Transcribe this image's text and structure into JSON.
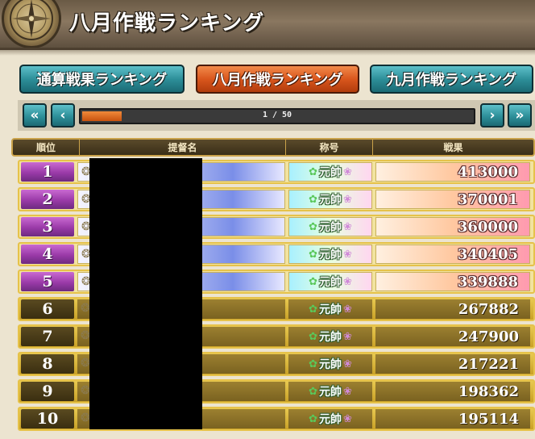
{
  "header": {
    "title": "八月作戦ランキング",
    "emblem_icon": "compass-icon"
  },
  "tabs": [
    {
      "label": "通算戦果ランキング",
      "active": false
    },
    {
      "label": "八月作戦ランキング",
      "active": true
    },
    {
      "label": "九月作戦ランキング",
      "active": false
    }
  ],
  "pager": {
    "first_label": "«",
    "prev_label": "‹",
    "next_label": "›",
    "last_label": "»",
    "page_text": "1 / 50",
    "current_page": 1,
    "total_pages": 50,
    "progress_fraction": 0.1
  },
  "table": {
    "headers": {
      "rank": "順位",
      "name": "提督名",
      "title": "称号",
      "score": "戦果"
    },
    "rows": [
      {
        "rank": "1",
        "title": "元帥",
        "score": "413000",
        "top": true
      },
      {
        "rank": "2",
        "title": "元帥",
        "score": "370001",
        "top": true
      },
      {
        "rank": "3",
        "title": "元帥",
        "score": "360000",
        "top": true
      },
      {
        "rank": "4",
        "title": "元帥",
        "score": "340405",
        "top": true
      },
      {
        "rank": "5",
        "title": "元帥",
        "score": "339888",
        "top": true
      },
      {
        "rank": "6",
        "title": "元帥",
        "score": "267882",
        "top": false
      },
      {
        "rank": "7",
        "title": "元帥",
        "score": "247900",
        "top": false
      },
      {
        "rank": "8",
        "title": "元帥",
        "score": "217221",
        "top": false
      },
      {
        "rank": "9",
        "title": "元帥",
        "score": "198362",
        "top": false
      },
      {
        "rank": "10",
        "title": "元帥",
        "score": "195114",
        "top": false
      }
    ]
  },
  "colors": {
    "accent_teal": "#2d8f99",
    "accent_orange": "#d9561d",
    "gold": "#e6c24a",
    "purple_rank": "#9a3aa8"
  }
}
